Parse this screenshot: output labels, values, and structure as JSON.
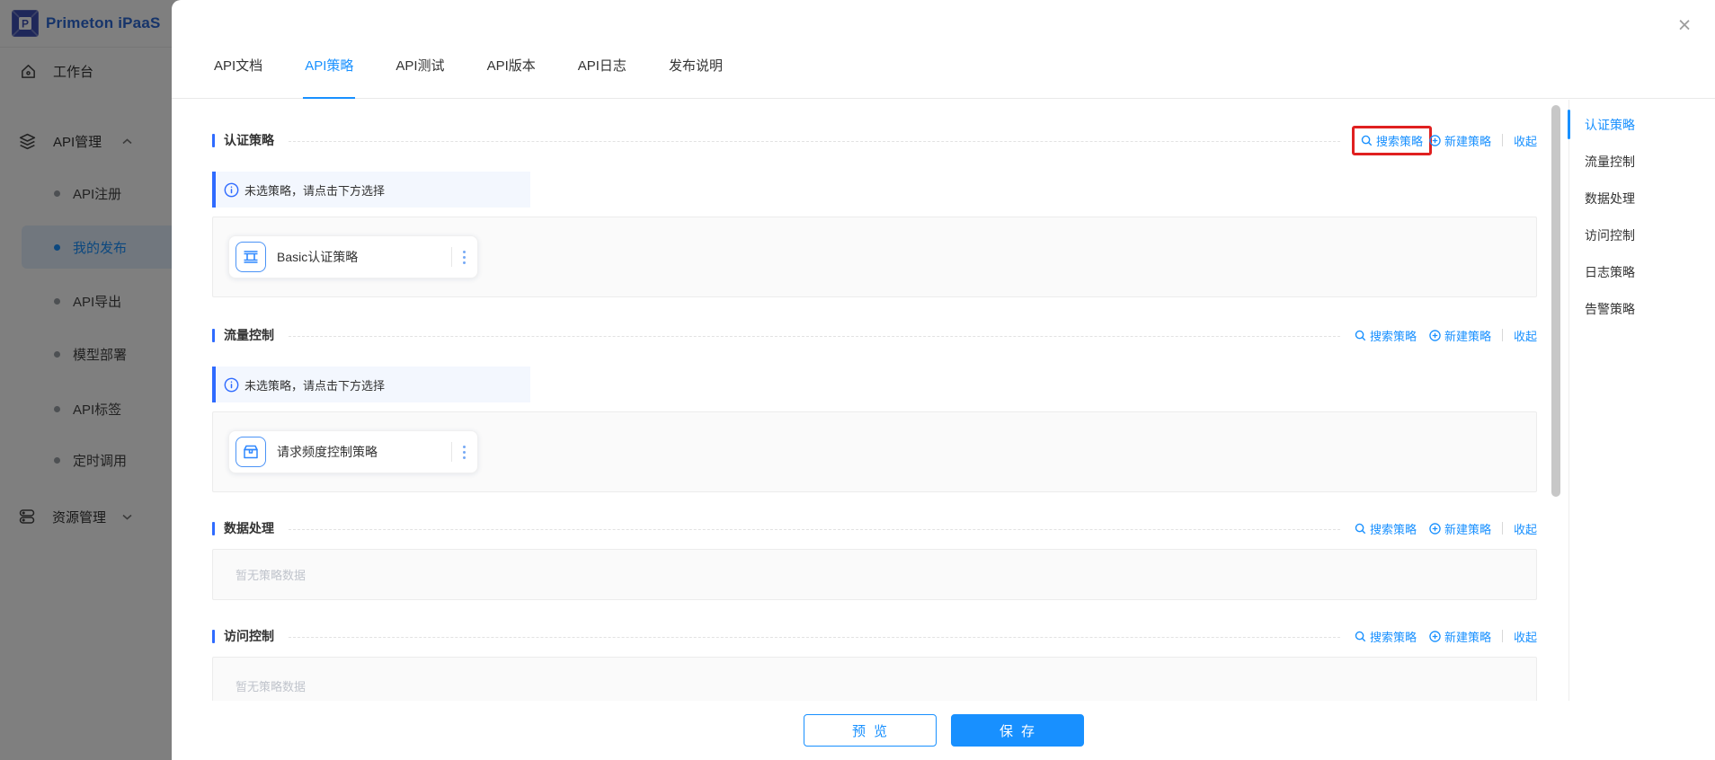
{
  "colors": {
    "accent": "#1890ff",
    "section_bar": "#2f6bff",
    "highlight_box": "#e02020",
    "overlay": "rgba(0,0,0,0.5)"
  },
  "header": {
    "brand": "Primeton iPaaS"
  },
  "sidebar": {
    "items": [
      {
        "label": "工作台"
      },
      {
        "label": "API管理"
      },
      {
        "label": "资源管理"
      }
    ],
    "api_children": [
      {
        "label": "API注册"
      },
      {
        "label": "我的发布"
      },
      {
        "label": "API导出"
      },
      {
        "label": "模型部署"
      },
      {
        "label": "API标签"
      },
      {
        "label": "定时调用"
      }
    ]
  },
  "modal": {
    "close_icon": "×",
    "tabs": [
      {
        "label": "API文档"
      },
      {
        "label": "API策略"
      },
      {
        "label": "API测试"
      },
      {
        "label": "API版本"
      },
      {
        "label": "API日志"
      },
      {
        "label": "发布说明"
      }
    ],
    "sections": [
      {
        "title": "认证策略",
        "search_label": "搜索策略",
        "create_label": "新建策略",
        "collapse_label": "收起",
        "banner": "未选策略，请点击下方选择",
        "card_label": "Basic认证策略"
      },
      {
        "title": "流量控制",
        "search_label": "搜索策略",
        "create_label": "新建策略",
        "collapse_label": "收起",
        "banner": "未选策略，请点击下方选择",
        "card_label": "请求频度控制策略"
      },
      {
        "title": "数据处理",
        "search_label": "搜索策略",
        "create_label": "新建策略",
        "collapse_label": "收起",
        "empty": "暂无策略数据"
      },
      {
        "title": "访问控制",
        "search_label": "搜索策略",
        "create_label": "新建策略",
        "collapse_label": "收起",
        "empty": "暂无策略数据"
      }
    ],
    "right_nav": [
      {
        "label": "认证策略"
      },
      {
        "label": "流量控制"
      },
      {
        "label": "数据处理"
      },
      {
        "label": "访问控制"
      },
      {
        "label": "日志策略"
      },
      {
        "label": "告警策略"
      }
    ],
    "footer": {
      "preview_label": "预览",
      "save_label": "保存"
    }
  }
}
